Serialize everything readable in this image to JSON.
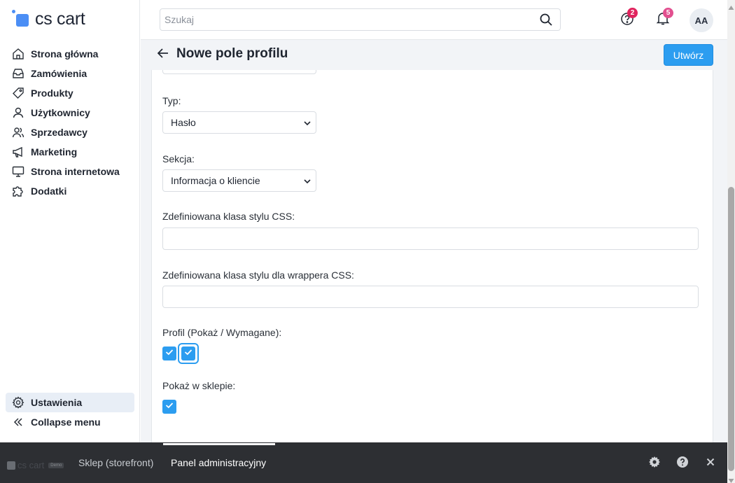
{
  "app": {
    "logo_text": "cs cart",
    "brand_color": "#4b8ef5",
    "accent_color": "#2c9df0"
  },
  "sidebar": {
    "items": [
      {
        "label": "Strona główna",
        "icon": "home-icon"
      },
      {
        "label": "Zamówienia",
        "icon": "inbox-icon"
      },
      {
        "label": "Produkty",
        "icon": "tag-icon"
      },
      {
        "label": "Użytkownicy",
        "icon": "user-icon"
      },
      {
        "label": "Sprzedawcy",
        "icon": "users-icon"
      },
      {
        "label": "Marketing",
        "icon": "megaphone-icon"
      },
      {
        "label": "Strona internetowa",
        "icon": "monitor-icon"
      },
      {
        "label": "Dodatki",
        "icon": "puzzle-icon"
      }
    ],
    "settings_label": "Ustawienia",
    "collapse_label": "Collapse menu"
  },
  "header": {
    "search_placeholder": "Szukaj",
    "help_badge": "2",
    "notifications_badge": "5",
    "avatar_initials": "AA",
    "badge_color": "#e0245e"
  },
  "page": {
    "title": "Nowe pole profilu",
    "create_button": "Utwórz"
  },
  "form": {
    "type_label": "Typ:",
    "type_value": "Hasło",
    "section_label": "Sekcja:",
    "section_value": "Informacja o kliencie",
    "css_class_label": "Zdefiniowana klasa stylu CSS:",
    "css_class_value": "",
    "wrapper_css_label": "Zdefiniowana klasa stylu dla wrappera CSS:",
    "wrapper_css_value": "",
    "profile_label": "Profil (Pokaż / Wymagane):",
    "profile_show_checked": true,
    "profile_required_checked": true,
    "storefront_label": "Pokaż w sklepie:",
    "storefront_checked": true
  },
  "bottom_bar": {
    "logo_text": "cs cart",
    "logo_badge": "Demo",
    "storefront_tab": "Sklep (storefront)",
    "admin_tab": "Panel administracyjny"
  }
}
